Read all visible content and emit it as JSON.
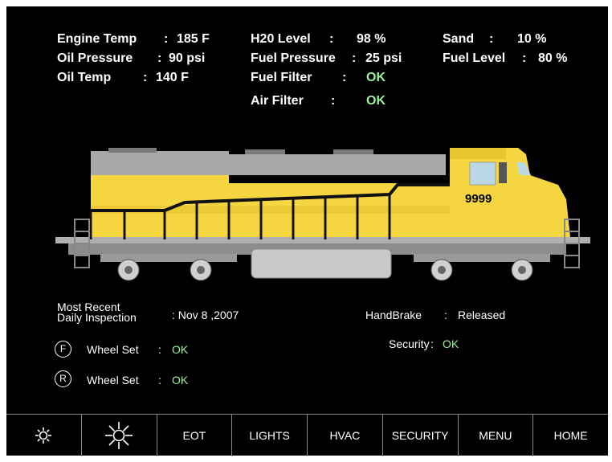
{
  "readings": {
    "engine_temp": {
      "label": "Engine Temp",
      "value": "185 F"
    },
    "oil_pressure": {
      "label": "Oil Pressure",
      "value": "90 psi"
    },
    "oil_temp": {
      "label": "Oil Temp",
      "value": "140 F"
    },
    "h2o_level": {
      "label": "H20 Level",
      "value": "98 %"
    },
    "fuel_pressure": {
      "label": "Fuel Pressure",
      "value": "25 psi"
    },
    "fuel_filter": {
      "label": "Fuel Filter",
      "value": "OK"
    },
    "air_filter": {
      "label": "Air Filter",
      "value": "OK"
    },
    "sand": {
      "label": "Sand",
      "value": "10 %"
    },
    "fuel_level": {
      "label": "Fuel Level",
      "value": "80 %"
    }
  },
  "locomotive": {
    "number": "9999"
  },
  "status": {
    "inspection_label_line1": "Most Recent",
    "inspection_label_line2": "Daily Inspection",
    "inspection_date": ": Nov  8 ,2007",
    "handbrake_label": "HandBrake",
    "handbrake_value": "Released",
    "security_label": "Security",
    "security_value": "OK",
    "front_wheel": {
      "marker": "F",
      "label": "Wheel Set",
      "value": "OK"
    },
    "rear_wheel": {
      "marker": "R",
      "label": "Wheel Set",
      "value": "OK"
    }
  },
  "toolbar": {
    "brightness_low_icon": "brightness-low-icon",
    "brightness_high_icon": "brightness-high-icon",
    "eot": "EOT",
    "lights": "LIGHTS",
    "hvac": "HVAC",
    "security": "SECURITY",
    "menu": "MENU",
    "home": "HOME"
  },
  "colors": {
    "background": "#000000",
    "ok": "#9df29d",
    "body_yellow": "#f6d640",
    "hood_gray": "#a8a8a8"
  }
}
